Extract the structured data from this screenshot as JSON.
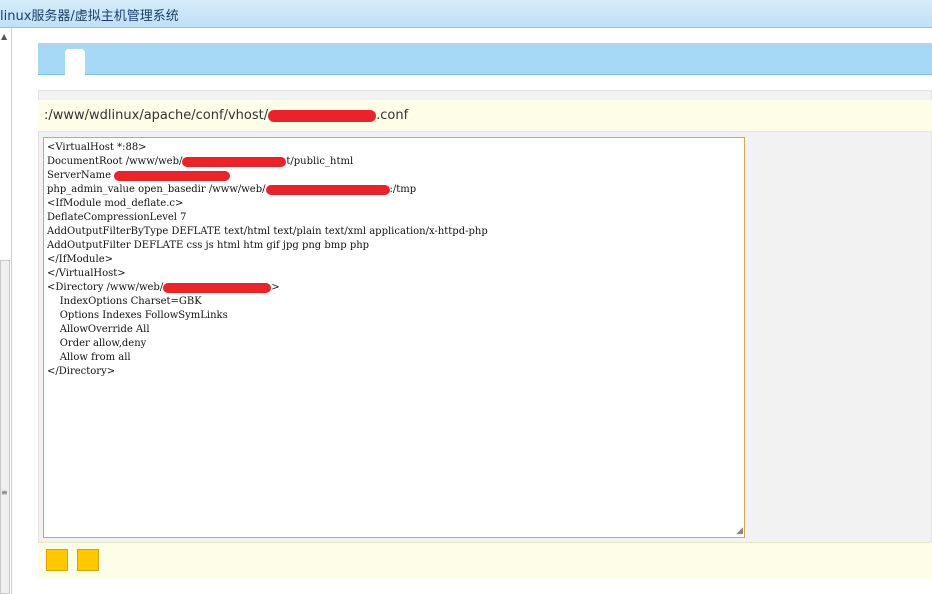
{
  "window": {
    "title": "linux服务器/虚拟主机管理系统"
  },
  "path": {
    "prefix": ":/www/wdlinux/apache/conf/vhost/",
    "suffix": ".conf"
  },
  "editor": {
    "lines": [
      "<VirtualHost *:88>",
      "DocumentRoot /www/web/",
      "t/public_html",
      "ServerName ",
      "php_admin_value open_basedir /www/web/",
      ":/tmp",
      "<IfModule mod_deflate.c>",
      "DeflateCompressionLevel 7",
      "AddOutputFilterByType DEFLATE text/html text/plain text/xml application/x-httpd-php",
      "AddOutputFilter DEFLATE css js html htm gif jpg png bmp php",
      "</IfModule>",
      "</VirtualHost>",
      "<Directory /www/web/",
      ">",
      "    IndexOptions Charset=GBK",
      "    Options Indexes FollowSymLinks",
      "    AllowOverride All",
      "    Order allow,deny",
      "    Allow from all",
      "</Directory>"
    ]
  },
  "colors": {
    "accent": "#a6d9f3",
    "button": "#ffc800",
    "redaction": "#e8232a"
  }
}
